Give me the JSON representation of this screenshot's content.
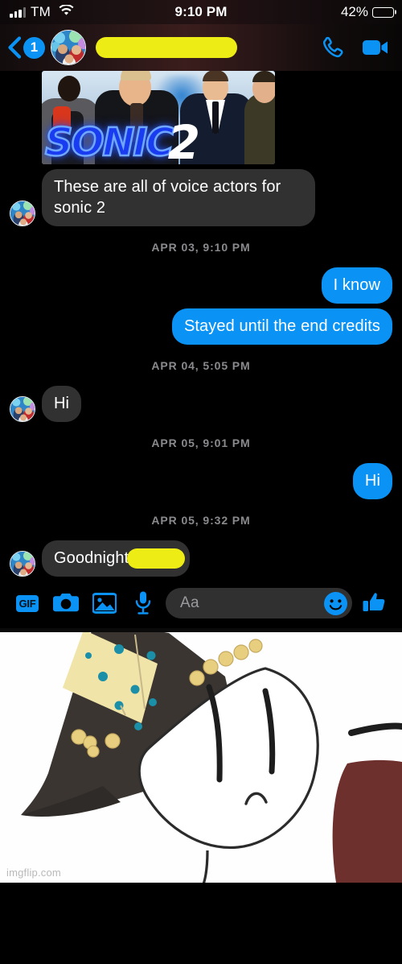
{
  "status_bar": {
    "carrier": "TM",
    "time": "9:10 PM",
    "battery_percent": "42%",
    "battery_level": 42,
    "signal_icon": "signal-bars-icon",
    "wifi_icon": "wifi-icon",
    "battery_icon": "battery-icon"
  },
  "thread_header": {
    "back_icon": "chevron-left-icon",
    "unread_badge": "1",
    "avatar_icon": "contact-avatar",
    "contact_name_redacted": "",
    "call_icon": "phone-icon",
    "video_icon": "video-camera-icon"
  },
  "conversation": {
    "messages": [
      {
        "id": "m1",
        "sender": "them",
        "type": "photo",
        "alt": "Sonic 2 movie poster with voice actors",
        "poster_title": "SONIC",
        "poster_number": "2"
      },
      {
        "id": "m2",
        "sender": "them",
        "type": "text",
        "text": "These are all of voice actors for sonic 2"
      },
      {
        "id": "d1",
        "type": "divider",
        "text": "APR 03, 9:10 PM"
      },
      {
        "id": "m3",
        "sender": "me",
        "type": "text",
        "text": "I know"
      },
      {
        "id": "m4",
        "sender": "me",
        "type": "text",
        "text": "Stayed until the end credits"
      },
      {
        "id": "d2",
        "type": "divider",
        "text": "APR 04, 5:05 PM"
      },
      {
        "id": "m5",
        "sender": "them",
        "type": "text",
        "text": "Hi"
      },
      {
        "id": "d3",
        "type": "divider",
        "text": "APR 05, 9:01 PM"
      },
      {
        "id": "m6",
        "sender": "me",
        "type": "text",
        "text": "Hi"
      },
      {
        "id": "d4",
        "type": "divider",
        "text": "APR 05, 9:32 PM"
      },
      {
        "id": "m7",
        "sender": "them",
        "type": "text_redacted",
        "text": "Goodnight"
      }
    ]
  },
  "composer": {
    "gif_label": "GIF",
    "gif_icon": "gif-icon",
    "camera_icon": "camera-icon",
    "gallery_icon": "photo-gallery-icon",
    "microphone_icon": "microphone-icon",
    "input_placeholder": "Aa",
    "input_value": "",
    "emoji_icon": "smiley-face-icon",
    "like_icon": "thumbs-up-icon"
  },
  "meme": {
    "watermark": "imgflip.com",
    "description": "cartoon face with pirate hat"
  },
  "colors": {
    "accent_blue": "#0a93f5",
    "bubble_gray": "#313131",
    "redaction_yellow": "#eded15",
    "background": "#000000",
    "divider_text": "#8a8a8e"
  }
}
